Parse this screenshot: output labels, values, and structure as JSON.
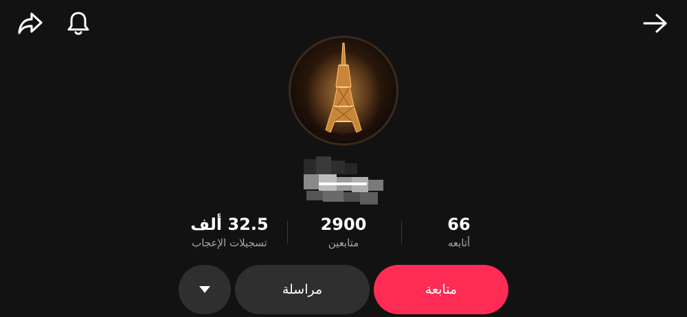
{
  "topbar": {
    "share_icon": "share-arrow-icon",
    "bell_icon": "bell-icon",
    "back_icon": "arrow-right-icon"
  },
  "profile": {
    "avatar_description_icon": "eiffel-tower-avatar"
  },
  "stats": {
    "likes": {
      "value": "32.5 ألف",
      "label": "تسجيلات الإعجاب"
    },
    "followers": {
      "value": "2900",
      "label": "متابعين"
    },
    "following": {
      "value": "66",
      "label": "أتابعه"
    }
  },
  "actions": {
    "follow_label": "متابعة",
    "message_label": "مراسلة",
    "more_icon": "triangle-down-icon"
  },
  "colors": {
    "background": "#121212",
    "follow_button": "#fe2c55",
    "secondary_button": "#2f2f2f",
    "label_gray": "#a8a8a8"
  }
}
